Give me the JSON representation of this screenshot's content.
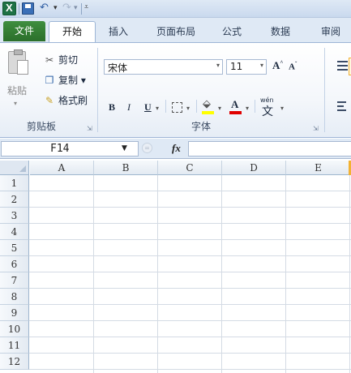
{
  "tabs": {
    "file": "文件",
    "home": "开始",
    "insert": "插入",
    "page_layout": "页面布局",
    "formulas": "公式",
    "data": "数据",
    "review": "审阅"
  },
  "clipboard": {
    "paste": "粘贴",
    "cut": "剪切",
    "copy": "复制",
    "copy_arrow": "▾",
    "format_painter": "格式刷",
    "group_label": "剪贴板"
  },
  "font": {
    "name": "宋体",
    "size": "11",
    "bold": "B",
    "italic": "I",
    "underline": "U",
    "font_color_letter": "A",
    "phonetic_top": "wén",
    "phonetic_char": "文",
    "group_label": "字体",
    "grow": "A",
    "shrink": "A",
    "fill_color": "#ffff00",
    "font_color": "#e00000"
  },
  "formula_bar": {
    "name_box": "F14",
    "fx": "fx",
    "formula": ""
  },
  "grid": {
    "columns": [
      "A",
      "B",
      "C",
      "D",
      "E"
    ],
    "rows": [
      "1",
      "2",
      "3",
      "4",
      "5",
      "6",
      "7",
      "8",
      "9",
      "10",
      "11",
      "12"
    ]
  },
  "icons": {
    "excel": "excel-logo-icon",
    "save": "save-icon",
    "undo": "undo-icon",
    "redo": "redo-icon",
    "paste": "paste-icon",
    "cut": "scissors-icon",
    "copy": "copy-icon",
    "format_painter": "brush-icon",
    "fill": "paint-bucket-icon"
  },
  "colors": {
    "file_tab": "#2b6f2b",
    "ribbon_border": "#9db5d6"
  }
}
